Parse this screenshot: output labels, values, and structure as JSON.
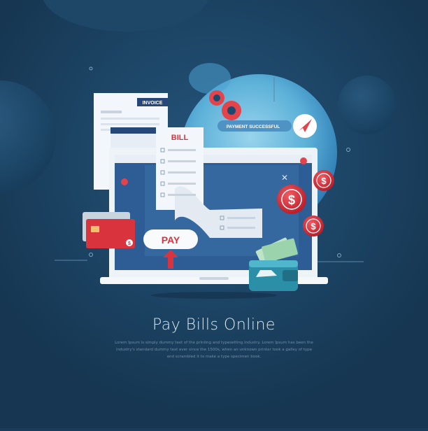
{
  "invoice": {
    "label": "INVOICE"
  },
  "bill": {
    "label": "BILL"
  },
  "payment": {
    "status": "PAYMENT SUCCESSFUL"
  },
  "pay_button": {
    "label": "PAY"
  },
  "coins": [
    {
      "symbol": "$"
    },
    {
      "symbol": "$"
    },
    {
      "symbol": "$"
    }
  ],
  "card": {
    "logo": "$"
  },
  "headline": {
    "title": "Pay Bills Online"
  },
  "description": "Lorem Ipsum is simply dummy text of the printing and typesetting industry. Lorem Ipsum has been the industry's standard dummy text ever since the 1500s, when an unknown printer took a galley of type and scrambled it to make a type specimen book.",
  "colors": {
    "background": "#1a3d5c",
    "accent_red": "#d9343d",
    "bubble": "#6fc3e6",
    "laptop_screen": "#2d5d94",
    "wallet": "#2b8fa8"
  }
}
